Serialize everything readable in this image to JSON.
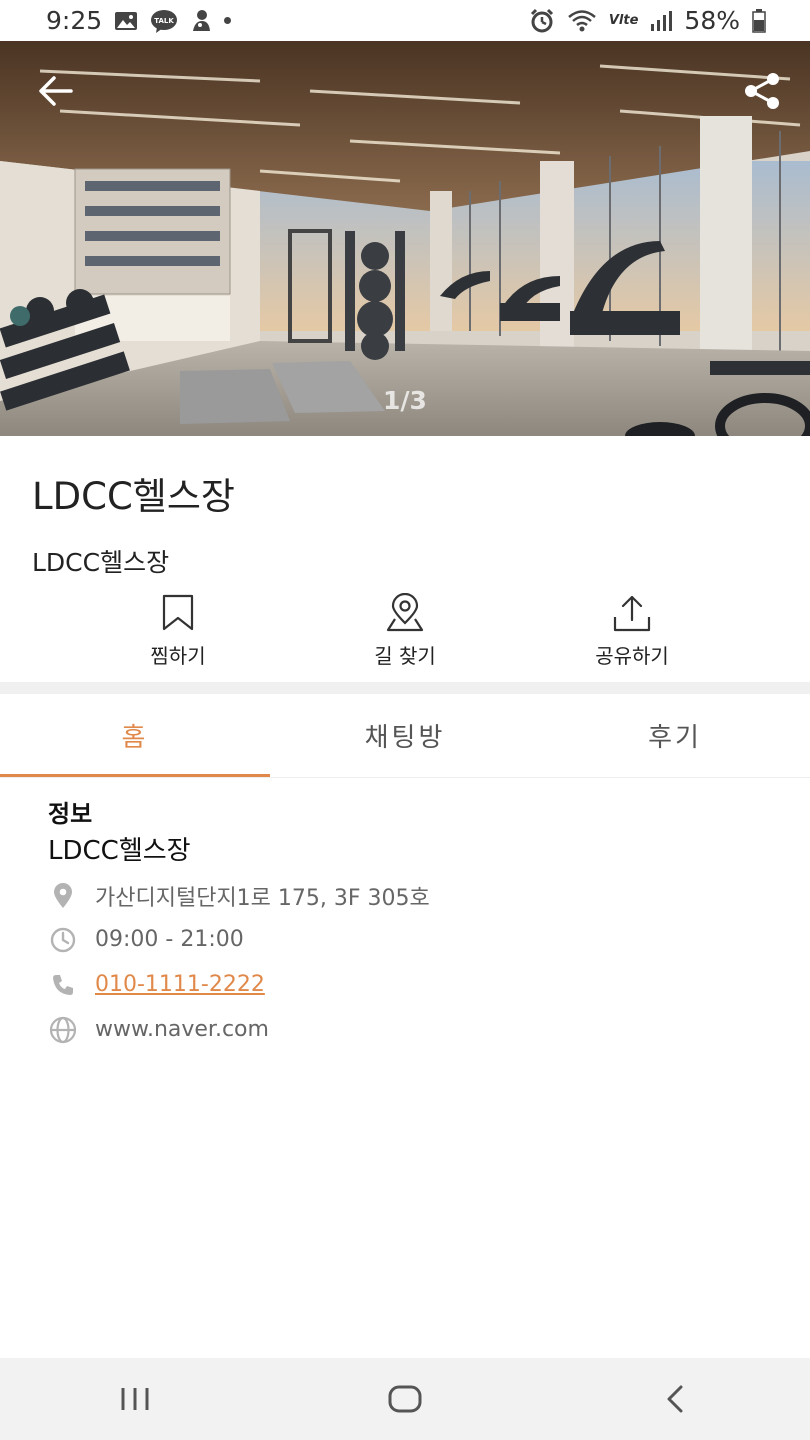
{
  "status_bar": {
    "time": "9:25",
    "battery": "58%",
    "icons": [
      "gallery-icon",
      "kakaotalk-icon",
      "ghost-icon",
      "dot-icon",
      "alarm-icon",
      "wifi-icon",
      "volte-icon",
      "signal-icon",
      "battery-icon"
    ],
    "volte_label": "Vlte"
  },
  "hero": {
    "page_indicator": "1/3",
    "back_icon": "arrow-left-icon",
    "share_icon": "share-icon"
  },
  "place": {
    "title": "LDCC헬스장",
    "subtitle": "LDCC헬스장"
  },
  "actions": [
    {
      "label": "찜하기",
      "icon": "bookmark-icon"
    },
    {
      "label": "길 찾기",
      "icon": "map-pin-icon"
    },
    {
      "label": "공유하기",
      "icon": "upload-icon"
    }
  ],
  "tabs": [
    {
      "label": "홈",
      "active": true
    },
    {
      "label": "채팅방",
      "active": false
    },
    {
      "label": "후기",
      "active": false
    }
  ],
  "info": {
    "heading": "정보",
    "name": "LDCC헬스장",
    "address": "가산디지털단지1로 175, 3F 305호",
    "hours": "09:00 - 21:00",
    "phone": "010-1111-2222",
    "website": "www.naver.com"
  },
  "colors": {
    "accent": "#e0894a",
    "text_primary": "#222222",
    "text_secondary": "#666666",
    "nav_bg": "#f2f2f2"
  }
}
